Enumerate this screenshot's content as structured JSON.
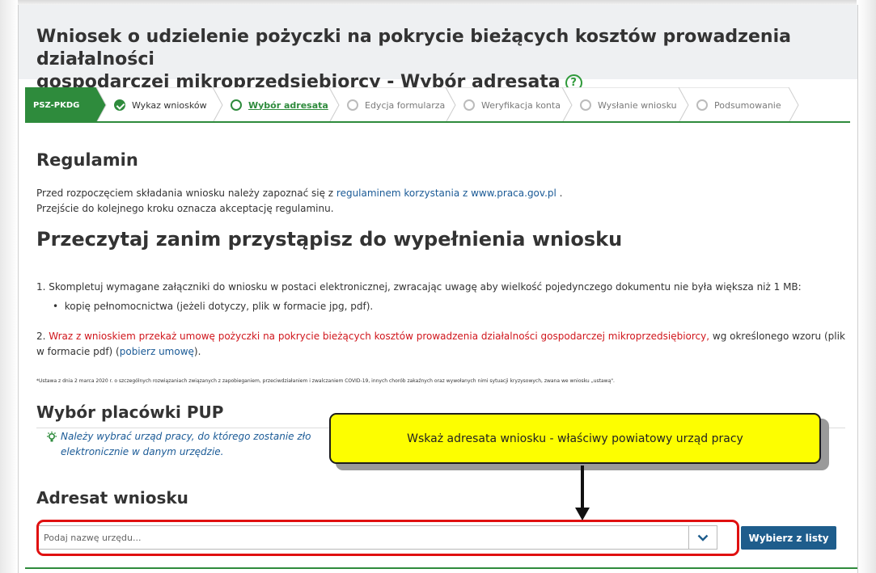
{
  "page": {
    "title_line1": "Wniosek o udzielenie pożyczki na pokrycie bieżących kosztów prowadzenia działalności",
    "title_line2": "gospodarczej mikroprzedsiębiorcy - Wybór adresata",
    "help_icon_glyph": "?"
  },
  "stepper": {
    "brand": "PSZ-PKDG",
    "steps": [
      {
        "label": "Wykaz wniosków",
        "state": "done"
      },
      {
        "label": "Wybór adresata",
        "state": "active"
      },
      {
        "label": "Edycja formularza",
        "state": "pending"
      },
      {
        "label": "Weryfikacja konta",
        "state": "pending"
      },
      {
        "label": "Wysłanie wniosku",
        "state": "pending"
      },
      {
        "label": "Podsumowanie",
        "state": "pending"
      }
    ],
    "active_color": "#2e8b3c"
  },
  "regulamin": {
    "heading": "Regulamin",
    "line1_prefix": "Przed rozpoczęciem składania wniosku należy zapoznać się z ",
    "line1_link": "regulaminem korzystania z www.praca.gov.pl",
    "line1_suffix": " .",
    "line2": "Przejście do kolejnego kroku oznacza akceptację regulaminu."
  },
  "instructions": {
    "heading": "Przeczytaj zanim przystąpisz do wypełnienia wniosku",
    "item1": "1. Skompletuj wymagane załączniki do wniosku w postaci elektronicznej, zwracając uwagę aby wielkość pojedynczego dokumentu nie była większa niż 1 MB:",
    "item1_bullet": "kopię pełnomocnictwa (jeżeli dotyczy, plik w formacie jpg, pdf).",
    "item2_prefix": "2. ",
    "item2_red": "Wraz z wnioskiem przekaż umowę pożyczki na pokrycie bieżących kosztów prowadzenia działalności gospodarczej mikroprzedsiębiorcy,",
    "item2_suffix": " wg określonego wzoru (plik",
    "item2_line2_prefix": "w formacie pdf) (",
    "item2_link": "pobierz umowę",
    "item2_line2_suffix": ").",
    "footnote": "*Ustawa z dnia 2 marca 2020 r. o szczególnych rozwiązaniach związanych z zapobieganiem, przeciwdziałaniem i zwalczaniem COVID-19, innych chorób zakaźnych oraz wywołanych nimi sytuacji kryzysowych, zwana we wniosku „ustawą\"."
  },
  "pup": {
    "heading": "Wybór placówki PUP",
    "info_line1": "Należy wybrać urząd pracy, do którego zostanie zło",
    "info_line2": "elektronicznie w danym urzędzie.",
    "bulb_icon": "lightbulb-icon"
  },
  "adresat": {
    "heading": "Adresat wniosku",
    "placeholder": "Podaj nazwę urzędu...",
    "pick_button": "Wybierz z listy",
    "button_color": "#1e5d8c"
  },
  "callout": {
    "text": "Wskaż adresata wniosku - właściwy powiatowy urząd pracy",
    "color": "#fdfe00",
    "highlight_color": "#e01010"
  }
}
